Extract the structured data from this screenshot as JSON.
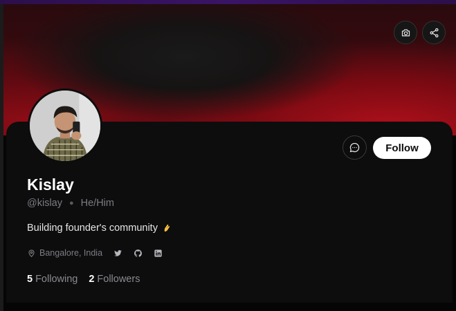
{
  "profile": {
    "name": "Kislay",
    "handle": "@kislay",
    "pronouns": "He/Him",
    "bio": "Building founder's community",
    "location": "Bangalore, India"
  },
  "actions": {
    "follow_label": "Follow"
  },
  "stats": {
    "following_count": "5",
    "following_label": "Following",
    "followers_count": "2",
    "followers_label": "Followers"
  },
  "icons": {
    "cover": [
      "camera-icon",
      "share-icon"
    ],
    "actions": [
      "message-icon"
    ],
    "meta": [
      "location-pin-icon",
      "twitter-icon",
      "github-icon",
      "linkedin-icon"
    ],
    "bio_emoji": "pinching-hand-icon"
  },
  "colors": {
    "accent_red": "#b0101b",
    "card_bg": "#0d0d0d",
    "follow_bg": "#ffffff",
    "muted_text": "#7c7c84"
  }
}
